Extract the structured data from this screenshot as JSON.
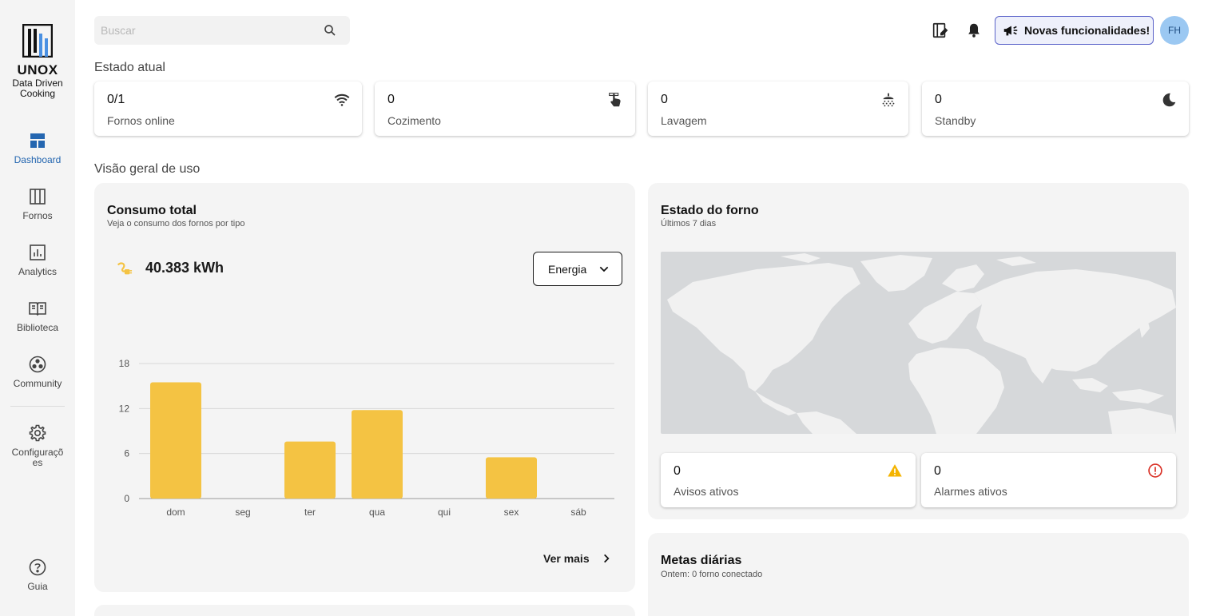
{
  "brand": {
    "name": "UNOX",
    "tagline_1": "Data Driven",
    "tagline_2": "Cooking"
  },
  "sidebar": {
    "items": [
      {
        "label": "Dashboard",
        "icon": "dashboard-icon",
        "active": true
      },
      {
        "label": "Fornos",
        "icon": "ovens-icon"
      },
      {
        "label": "Analytics",
        "icon": "analytics-icon"
      },
      {
        "label": "Biblioteca",
        "icon": "library-icon"
      },
      {
        "label": "Community",
        "icon": "community-icon"
      },
      {
        "label": "Configuraçõ es",
        "icon": "gear-icon"
      }
    ],
    "help": {
      "label": "Guia",
      "icon": "help-icon"
    }
  },
  "search": {
    "placeholder": "Buscar",
    "value": ""
  },
  "topbar": {
    "news_label": "Novas funcionalidades!",
    "avatar_initials": "FH",
    "accent": "#5b63c9"
  },
  "estado_atual": {
    "title": "Estado atual",
    "cards": [
      {
        "value": "0/1",
        "label": "Fornos online",
        "icon": "wifi-icon"
      },
      {
        "value": "0",
        "label": "Cozimento",
        "icon": "touch-icon"
      },
      {
        "value": "0",
        "label": "Lavagem",
        "icon": "shower-icon"
      },
      {
        "value": "0",
        "label": "Standby",
        "icon": "moon-icon"
      }
    ]
  },
  "visao_geral": {
    "title": "Visão geral de uso"
  },
  "consumo": {
    "title": "Consumo total",
    "subtitle": "Veja o consumo dos fornos por tipo",
    "total": "40.383 kWh",
    "select_value": "Energia",
    "see_more": "Ver mais"
  },
  "chart_data": {
    "type": "bar",
    "categories": [
      "dom",
      "seg",
      "ter",
      "qua",
      "qui",
      "sex",
      "sáb"
    ],
    "values": [
      15.5,
      0,
      7.6,
      11.8,
      0,
      5.5,
      0
    ],
    "yticks": [
      "0",
      "6",
      "12",
      "18"
    ],
    "ylim": [
      0,
      18
    ],
    "grid": true,
    "color": "#f4c343",
    "xlabel": "",
    "ylabel": ""
  },
  "estado_forno": {
    "title": "Estado do forno",
    "subtitle": "Últimos 7 dias",
    "avisos": {
      "value": "0",
      "label": "Avisos ativos",
      "icon": "warning-icon",
      "color": "#f4b400"
    },
    "alarmes": {
      "value": "0",
      "label": "Alarmes ativos",
      "icon": "alarm-icon",
      "color": "#d93025"
    }
  },
  "metas": {
    "title": "Metas diárias",
    "subtitle": "Ontem: 0 forno conectado"
  }
}
